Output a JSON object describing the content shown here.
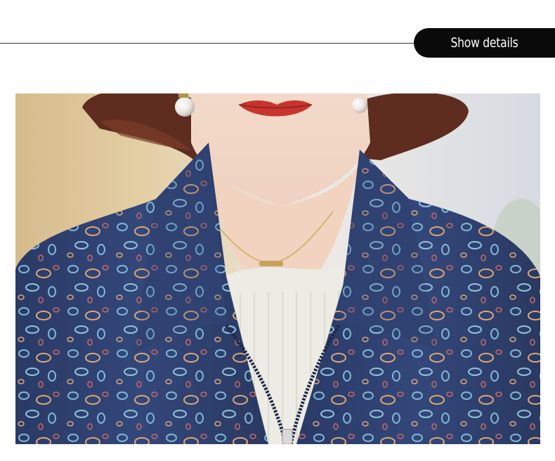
{
  "header": {
    "details_label": "Show details"
  },
  "photo": {
    "subject": "product-photo"
  },
  "colors": {
    "tab_background": "#0a0a0a",
    "tab_text": "#ffffff",
    "jacket": "#2c3b64",
    "background_left": "#d4b889",
    "background_right": "#d9dde4"
  }
}
